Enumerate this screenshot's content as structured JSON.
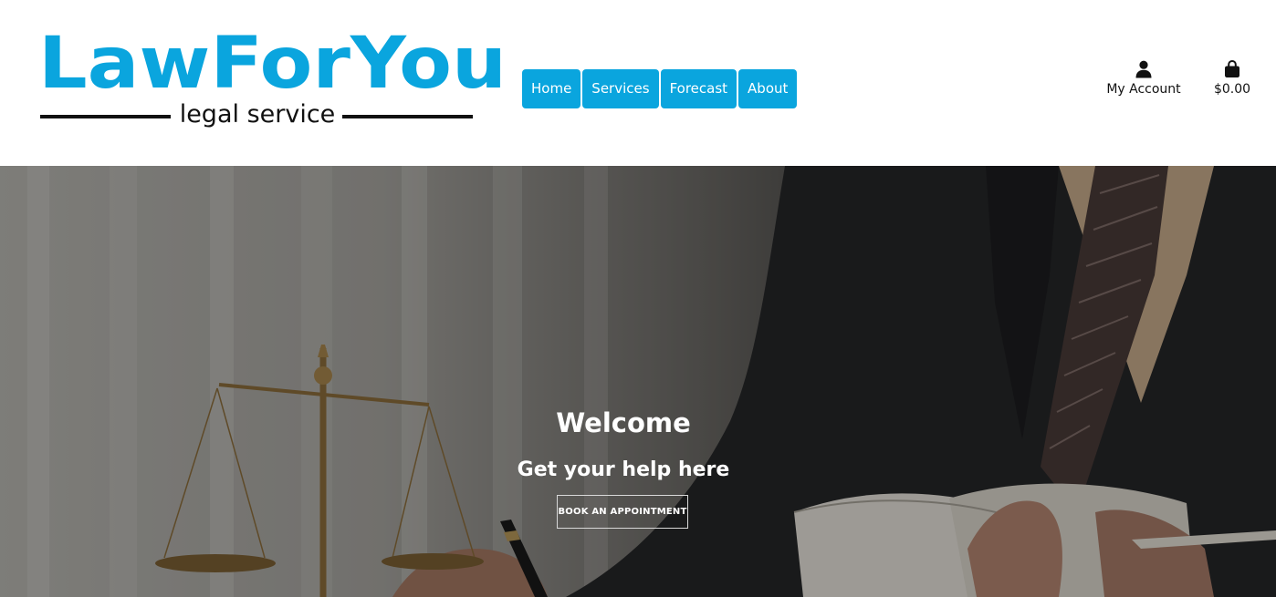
{
  "logo": {
    "title": "LawForYou",
    "subtitle": "legal service"
  },
  "nav": {
    "items": [
      "Home",
      "Services",
      "Forecast",
      "About"
    ]
  },
  "header": {
    "account_label": "My Account",
    "cart_total": "$0.00"
  },
  "hero": {
    "title": "Welcome",
    "subtitle": "Get your help here",
    "button_label": "Book an appointment"
  },
  "icons": {
    "account": "user-icon",
    "cart": "shopping-bag-icon"
  },
  "colors": {
    "brand": "#0aa5de",
    "text": "#111111",
    "hero_text": "#ffffff"
  }
}
